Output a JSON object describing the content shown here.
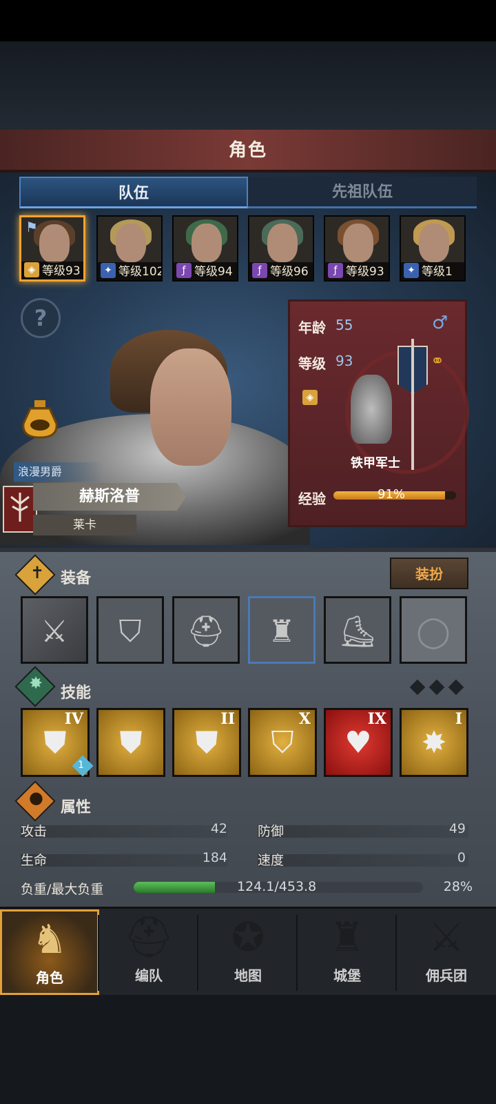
{
  "header": {
    "title": "角色"
  },
  "tabs": [
    {
      "label": "队伍"
    },
    {
      "label": "先祖队伍"
    }
  ],
  "party": [
    {
      "level": "等级93",
      "class_icon": "shield-icon"
    },
    {
      "level": "等级102",
      "class_icon": "sword-icon"
    },
    {
      "level": "等级94",
      "class_icon": "staff-icon"
    },
    {
      "level": "等级96",
      "class_icon": "staff-icon"
    },
    {
      "level": "等级93",
      "class_icon": "staff-icon"
    },
    {
      "level": "等级1",
      "class_icon": "sword-icon"
    }
  ],
  "help": {
    "symbol": "?"
  },
  "hero": {
    "title": "浪漫男爵",
    "name": "赫斯洛普",
    "origin": "莱卡"
  },
  "info": {
    "age_label": "年龄",
    "age": "55",
    "level_label": "等级",
    "level": "93",
    "gender_symbol": "♂",
    "class_name": "铁甲军士",
    "exp_label": "经验",
    "exp": "91%",
    "exp_fraction": 0.91
  },
  "equipment": {
    "title": "装备",
    "outfit_button": "装扮",
    "slots": [
      "banner-weapon-icon",
      "shield-icon",
      "helmet-icon",
      "armor-icon",
      "boots-icon",
      "ring-icon"
    ]
  },
  "skills": {
    "title": "技能",
    "items": [
      {
        "rank": "IV",
        "icon": "shield-strike-icon",
        "badge": "1"
      },
      {
        "rank": "",
        "icon": "weight-shield-icon"
      },
      {
        "rank": "II",
        "icon": "shield-fist-icon"
      },
      {
        "rank": "X",
        "icon": "shield-icon"
      },
      {
        "rank": "IX",
        "icon": "heartbeat-icon"
      },
      {
        "rank": "I",
        "icon": "shield-break-icon"
      }
    ]
  },
  "attributes": {
    "title": "属性",
    "attack_label": "攻击",
    "attack": "42",
    "defense_label": "防御",
    "defense": "49",
    "hp_label": "生命",
    "hp": "184",
    "speed_label": "速度",
    "speed": "0",
    "load_label": "负重/最大负重",
    "load": "124.1/453.8",
    "load_percent": "28%",
    "load_fraction": 0.28
  },
  "nav": [
    {
      "label": "角色",
      "icon": "knight-icon"
    },
    {
      "label": "编队",
      "icon": "helmet-icon"
    },
    {
      "label": "地图",
      "icon": "compass-icon"
    },
    {
      "label": "城堡",
      "icon": "castle-icon"
    },
    {
      "label": "佣兵团",
      "icon": "mercenary-icon"
    }
  ],
  "colors": {
    "accent": "#f0a430",
    "exp": "#f2b640",
    "load": "#3fa03f",
    "tab_active": "#2c5480"
  }
}
